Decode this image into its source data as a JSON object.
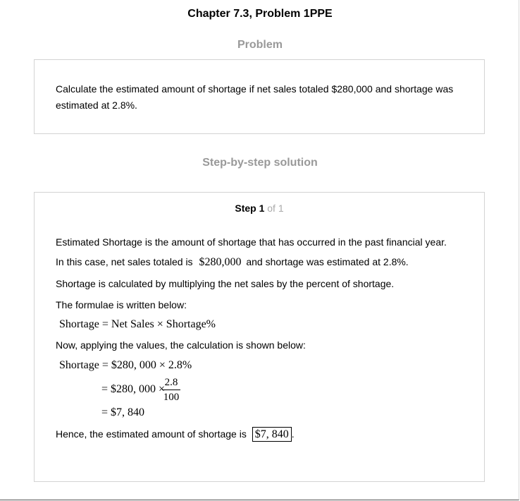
{
  "header": {
    "title": "Chapter 7.3, Problem 1PPE"
  },
  "problem": {
    "heading": "Problem",
    "text": "Calculate the estimated amount of shortage if net sales totaled $280,000 and shortage was estimated at 2.8%."
  },
  "solution": {
    "heading": "Step-by-step solution",
    "step_word": "Step 1",
    "step_of": "of 1",
    "para1": "Estimated Shortage is the amount of shortage that has occurred in the past financial year.",
    "para2_pre": "In this case, net sales totaled is",
    "para2_value": "$280,000",
    "para2_post": "and shortage was estimated at 2.8%.",
    "para3": "Shortage is calculated by multiplying the net sales by the percent of shortage.",
    "para4": "The formulae is written below:",
    "formula": "Shortage = Net Sales × Shortage%",
    "para5": "Now, applying the values, the calculation is shown below:",
    "calc1": "Shortage = $280, 000 × 2.8%",
    "calc2_pre": "= $280, 000 ×",
    "calc2_num": "2.8",
    "calc2_den": "100",
    "calc3": "= $7, 840",
    "final_pre": "Hence, the estimated amount of shortage is",
    "final_answer": "$7, 840",
    "final_post": "."
  }
}
